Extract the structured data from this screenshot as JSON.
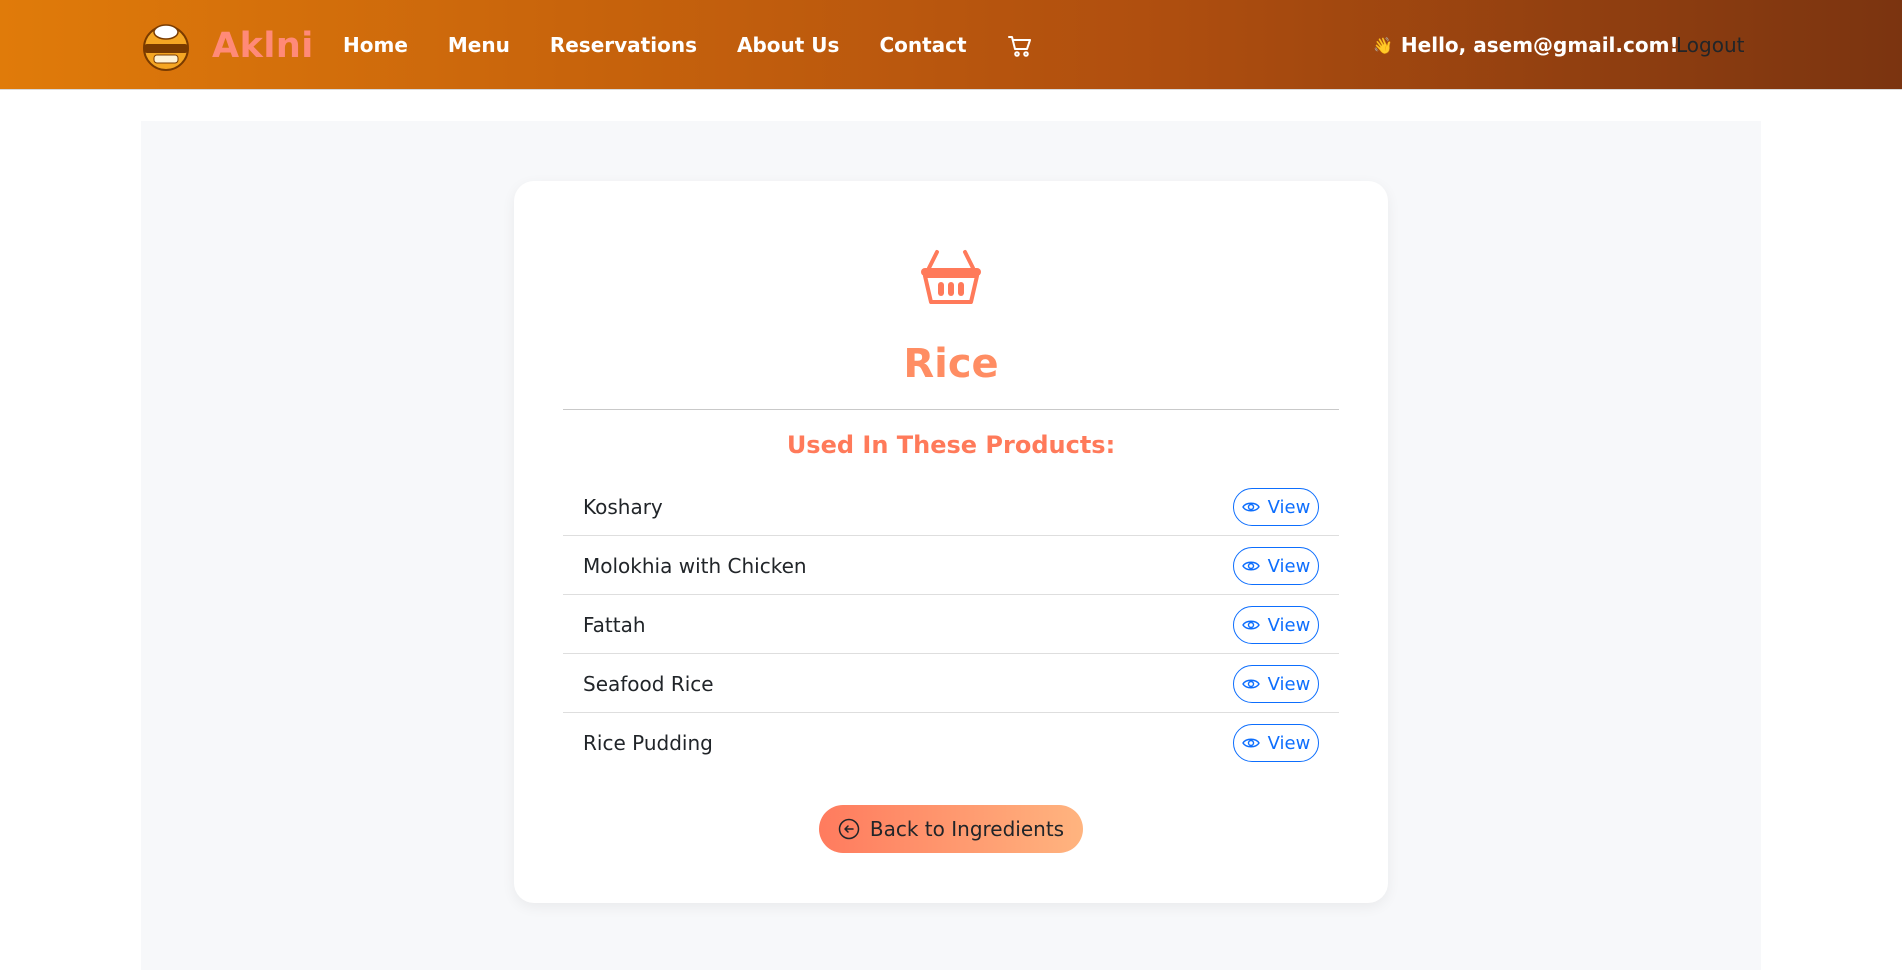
{
  "brand": {
    "name": "Aklni",
    "logo_icon": "restaurant-logo-icon"
  },
  "nav": {
    "items": [
      {
        "label": "Home"
      },
      {
        "label": "Menu"
      },
      {
        "label": "Reservations"
      },
      {
        "label": "About Us"
      },
      {
        "label": "Contact"
      }
    ],
    "cart_icon": "cart-icon"
  },
  "user": {
    "wave": "👋",
    "greeting": "Hello, asem@gmail.com!",
    "logout_label": "Logout"
  },
  "ingredient": {
    "icon": "basket-icon",
    "name": "Rice",
    "used_in_label": "Used In These Products:",
    "products": [
      {
        "name": "Koshary",
        "action": "View"
      },
      {
        "name": "Molokhia with Chicken",
        "action": "View"
      },
      {
        "name": "Fattah",
        "action": "View"
      },
      {
        "name": "Seafood Rice",
        "action": "View"
      },
      {
        "name": "Rice Pudding",
        "action": "View"
      }
    ],
    "back_label": "Back to Ingredients"
  },
  "colors": {
    "navbar_start": "#e07b0a",
    "navbar_end": "#7b3410",
    "brand": "#ff8a78",
    "accent": "#ff8d63",
    "link_blue": "#0d6efd"
  }
}
